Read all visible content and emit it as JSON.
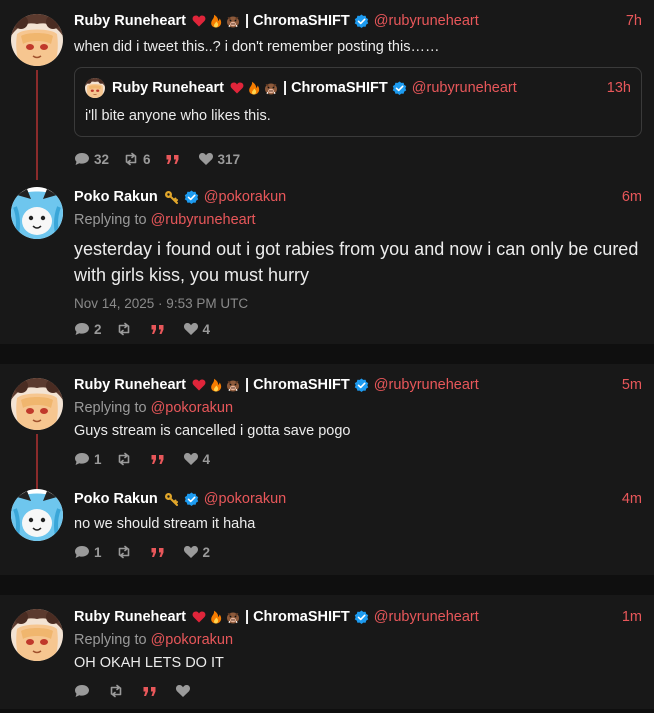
{
  "thread1": {
    "main": {
      "name": "Ruby Runeheart",
      "name_suffix": "| ChromaSHIFT",
      "handle": "@rubyruneheart",
      "time": "7h",
      "text": "when did i tweet this..? i don't remember posting this……",
      "quote": {
        "name": "Ruby Runeheart",
        "name_suffix": "| ChromaSHIFT",
        "handle": "@rubyruneheart",
        "time": "13h",
        "text": "i'll bite anyone who likes this."
      },
      "stats": {
        "replies": "32",
        "retweets": "6",
        "quotes": "",
        "likes": "317"
      }
    },
    "reply": {
      "name": "Poko Rakun",
      "handle": "@pokorakun",
      "time": "6m",
      "replying_prefix": "Replying to ",
      "replying_to": "@rubyruneheart",
      "text": "yesterday i found out i got rabies from you and now i can only be cured with girls kiss, you must hurry",
      "date": "Nov 14, 2025 · 9:53 PM UTC",
      "stats": {
        "replies": "2",
        "retweets": "",
        "quotes": "",
        "likes": "4"
      }
    }
  },
  "thread2": {
    "main": {
      "name": "Ruby Runeheart",
      "name_suffix": "| ChromaSHIFT",
      "handle": "@rubyruneheart",
      "time": "5m",
      "replying_prefix": "Replying to ",
      "replying_to": "@pokorakun",
      "text": "Guys stream is cancelled i gotta save pogo",
      "stats": {
        "replies": "1",
        "retweets": "",
        "quotes": "",
        "likes": "4"
      }
    },
    "reply": {
      "name": "Poko Rakun",
      "handle": "@pokorakun",
      "time": "4m",
      "text": "no we should stream it haha",
      "stats": {
        "replies": "1",
        "retweets": "",
        "quotes": "",
        "likes": "2"
      }
    }
  },
  "thread3": {
    "main": {
      "name": "Ruby Runeheart",
      "name_suffix": "| ChromaSHIFT",
      "handle": "@rubyruneheart",
      "time": "1m",
      "replying_prefix": "Replying to ",
      "replying_to": "@pokorakun",
      "text": "OH OKAH LETS DO IT",
      "stats": {
        "replies": "",
        "retweets": "",
        "quotes": "",
        "likes": ""
      }
    }
  },
  "colors": {
    "accent": "#e8575a",
    "verified": "#1d9bf0",
    "thread_line": "#8b2b2b"
  },
  "icons": [
    "heart-emoji",
    "fire-emoji",
    "boar-emoji",
    "key-emoji",
    "verified-badge-icon",
    "comment-icon",
    "retweet-icon",
    "quote-icon",
    "like-icon"
  ]
}
